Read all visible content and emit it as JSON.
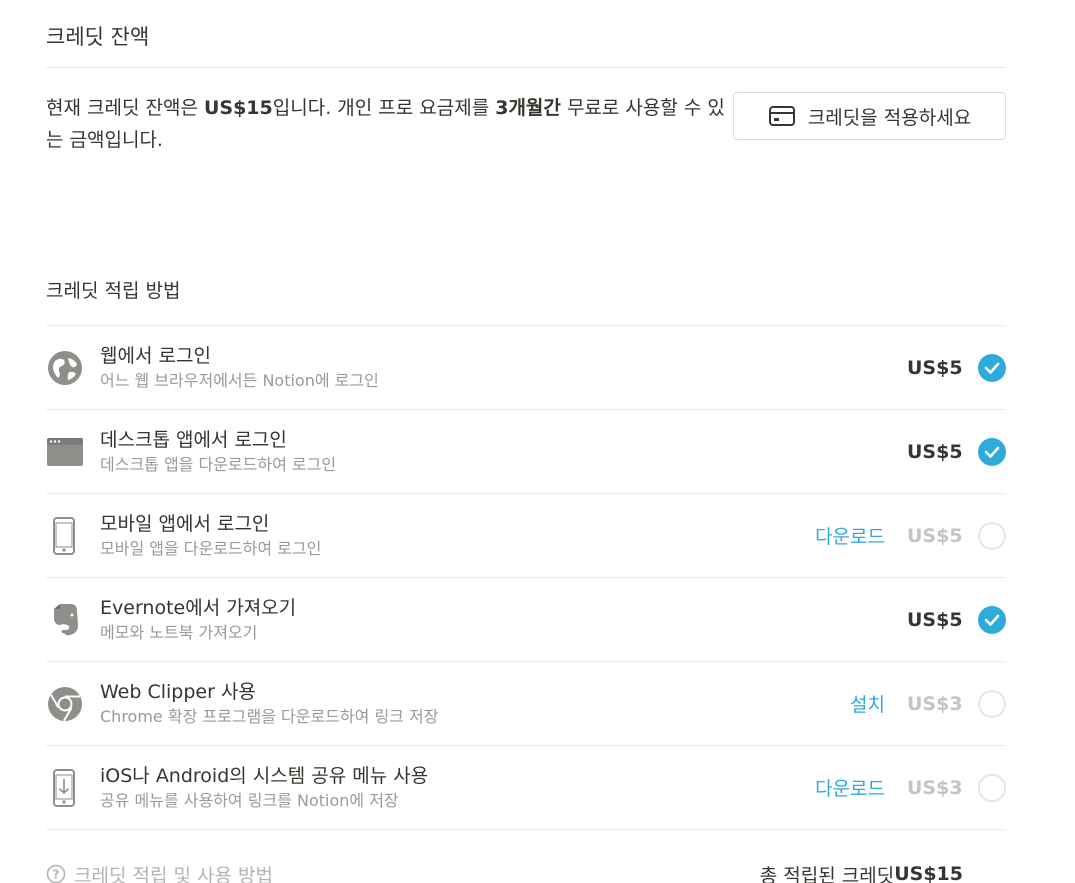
{
  "header": {
    "title": "크레딧 잔액"
  },
  "balance": {
    "text_before": "현재 크레딧 잔액은 ",
    "amount": "US$15",
    "text_mid": "입니다. 개인 프로 요금제를 ",
    "duration": "3개월간",
    "text_after": " 무료로 사용할 수 있는 금액입니다.",
    "apply_button_label": "크레딧을 적용하세요",
    "apply_button_icon": "credit-card-icon"
  },
  "earn": {
    "title": "크레딧 적립 방법",
    "items": [
      {
        "icon": "globe-icon",
        "title": "웹에서 로그인",
        "desc": "어느 웹 브라우저에서든 Notion에 로그인",
        "action": "",
        "amount": "US$5",
        "done": true
      },
      {
        "icon": "desktop-app-icon",
        "title": "데스크톱 앱에서 로그인",
        "desc": "데스크톱 앱을 다운로드하여 로그인",
        "action": "",
        "amount": "US$5",
        "done": true
      },
      {
        "icon": "mobile-phone-icon",
        "title": "모바일 앱에서 로그인",
        "desc": "모바일 앱을 다운로드하여 로그인",
        "action": "다운로드",
        "amount": "US$5",
        "done": false
      },
      {
        "icon": "evernote-elephant-icon",
        "title": "Evernote에서 가져오기",
        "desc": "메모와 노트북 가져오기",
        "action": "",
        "amount": "US$5",
        "done": true
      },
      {
        "icon": "chrome-icon",
        "title": "Web Clipper 사용",
        "desc": "Chrome 확장 프로그램을 다운로드하여 링크 저장",
        "action": "설치",
        "amount": "US$3",
        "done": false
      },
      {
        "icon": "mobile-download-icon",
        "title": "iOS나 Android의 시스템 공유 메뉴 사용",
        "desc": "공유 메뉴를 사용하여 링크를 Notion에 저장",
        "action": "다운로드",
        "amount": "US$3",
        "done": false
      }
    ]
  },
  "footer": {
    "help_label": "크레딧 적립 및 사용 방법",
    "help_icon": "question-circle-icon",
    "total_label": "총 적립된 크레딧",
    "total_value": "US$15"
  },
  "colors": {
    "accent": "#2eaadc",
    "muted": "#9b9a97",
    "text": "#37352f"
  }
}
